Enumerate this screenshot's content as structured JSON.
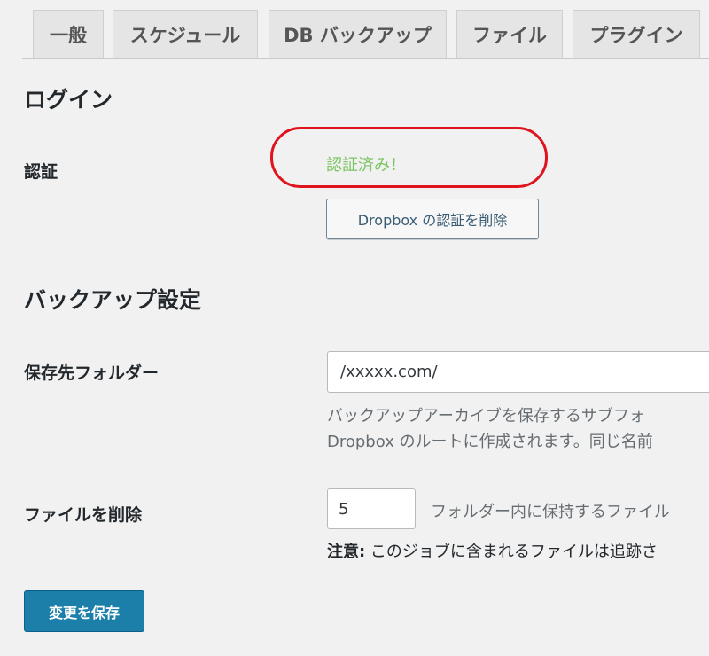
{
  "tabs": [
    {
      "label": "一般"
    },
    {
      "label": "スケジュール"
    },
    {
      "label": "DB バックアップ"
    },
    {
      "label": "ファイル"
    },
    {
      "label": "プラグイン"
    }
  ],
  "login": {
    "heading": "ログイン",
    "auth_label": "認証",
    "auth_status": "認証済み！",
    "auth_status_color": "#7ac362",
    "highlight_color": "#e0141d",
    "delete_auth_button": "Dropbox の認証を削除"
  },
  "backup_settings": {
    "heading": "バックアップ設定",
    "folder_label": "保存先フォルダー",
    "folder_value": "/xxxxx.com/",
    "folder_desc_line1": "バックアップアーカイブを保存するサブフォ",
    "folder_desc_line2": "Dropbox のルートに作成されます。同じ名前",
    "delete_files_label": "ファイルを削除",
    "delete_files_value": "5",
    "delete_files_desc": "フォルダー内に保持するファイル",
    "note_prefix": "注意:",
    "note_text": " このジョブに含まれるファイルは追跡さ"
  },
  "save_button": {
    "label": "変更を保存",
    "color": "#1c7faa"
  }
}
